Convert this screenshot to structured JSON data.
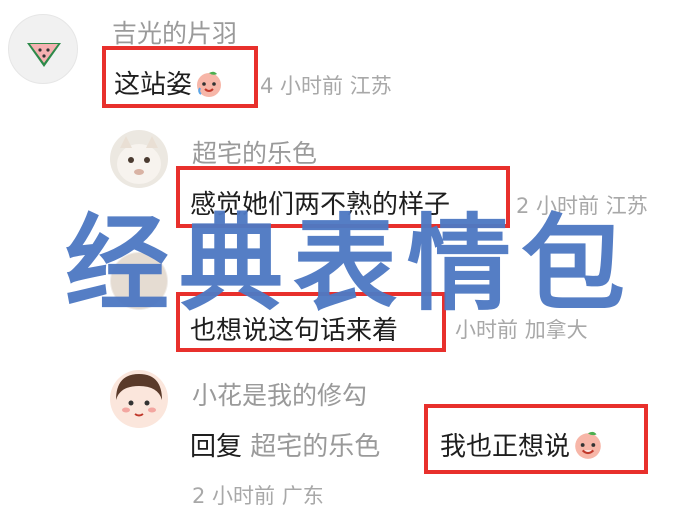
{
  "comments": [
    {
      "user": "吉光的片羽",
      "text": "这站姿",
      "time": "4 小时前",
      "location": "江苏",
      "avatar": "watermelon-avatar"
    },
    {
      "user": "超宅的乐色",
      "text": "感觉她们两不熟的样子",
      "time": "2 小时前",
      "location": "江苏",
      "avatar": "cat-avatar"
    },
    {
      "text": "也想说这句话来着",
      "time": "小时前",
      "location": "加拿大",
      "avatar": "partially-hidden-avatar"
    },
    {
      "user": "小花是我的修勾",
      "reply_prefix": "回复",
      "reply_to": "超宅的乐色",
      "text": "我也正想说",
      "time": "2 小时前",
      "location": "广东",
      "avatar": "cartoon-girl-avatar"
    }
  ],
  "overlay_title": "经典表情包",
  "colors": {
    "highlight": "#e8302c",
    "overlay": "#4f79c3",
    "meta": "#a8a8a8"
  },
  "icons": [
    "peach-face-emoji"
  ]
}
